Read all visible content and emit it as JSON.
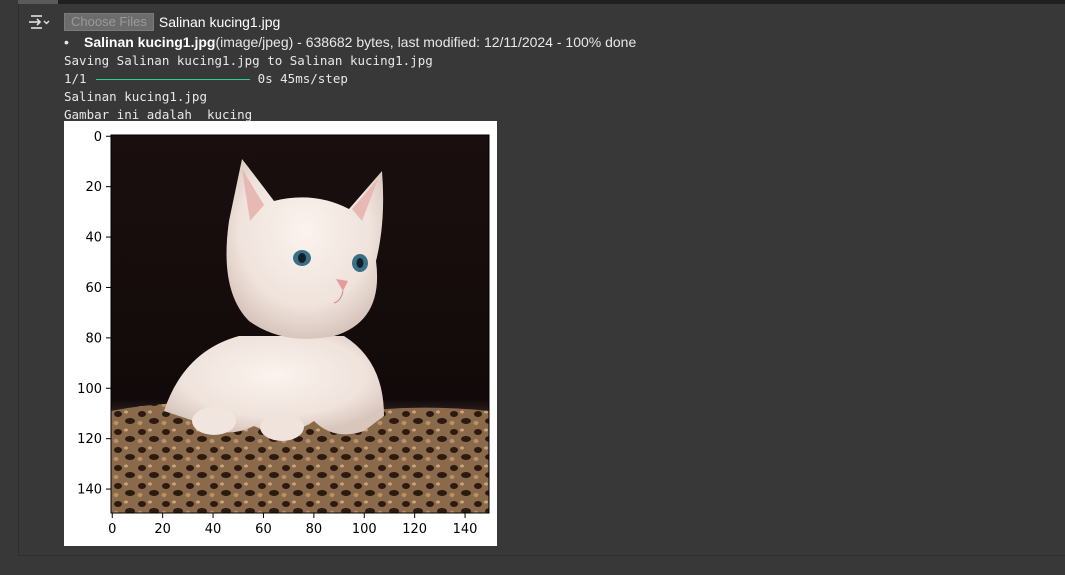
{
  "upload": {
    "button_label": "Choose Files",
    "selected_filename": "Salinan kucing1.jpg"
  },
  "file_info": {
    "name": "Salinan kucing1.jpg",
    "details": "(image/jpeg) - 638682 bytes, last modified: 12/11/2024 - 100% done"
  },
  "log": {
    "saving": "Saving Salinan kucing1.jpg to Salinan kucing1.jpg",
    "progress_step": "1/1",
    "progress_timing": "0s 45ms/step",
    "filename": "Salinan kucing1.jpg",
    "result": "Gambar ini adalah  kucing"
  },
  "plot": {
    "x_ticks": [
      "0",
      "20",
      "40",
      "60",
      "80",
      "100",
      "120",
      "140"
    ],
    "y_ticks": [
      "0",
      "20",
      "40",
      "60",
      "80",
      "100",
      "120",
      "140"
    ],
    "image_extent": [
      150,
      150
    ]
  },
  "colors": {
    "background": "#383838",
    "progress_bar": "#2bd08f"
  }
}
